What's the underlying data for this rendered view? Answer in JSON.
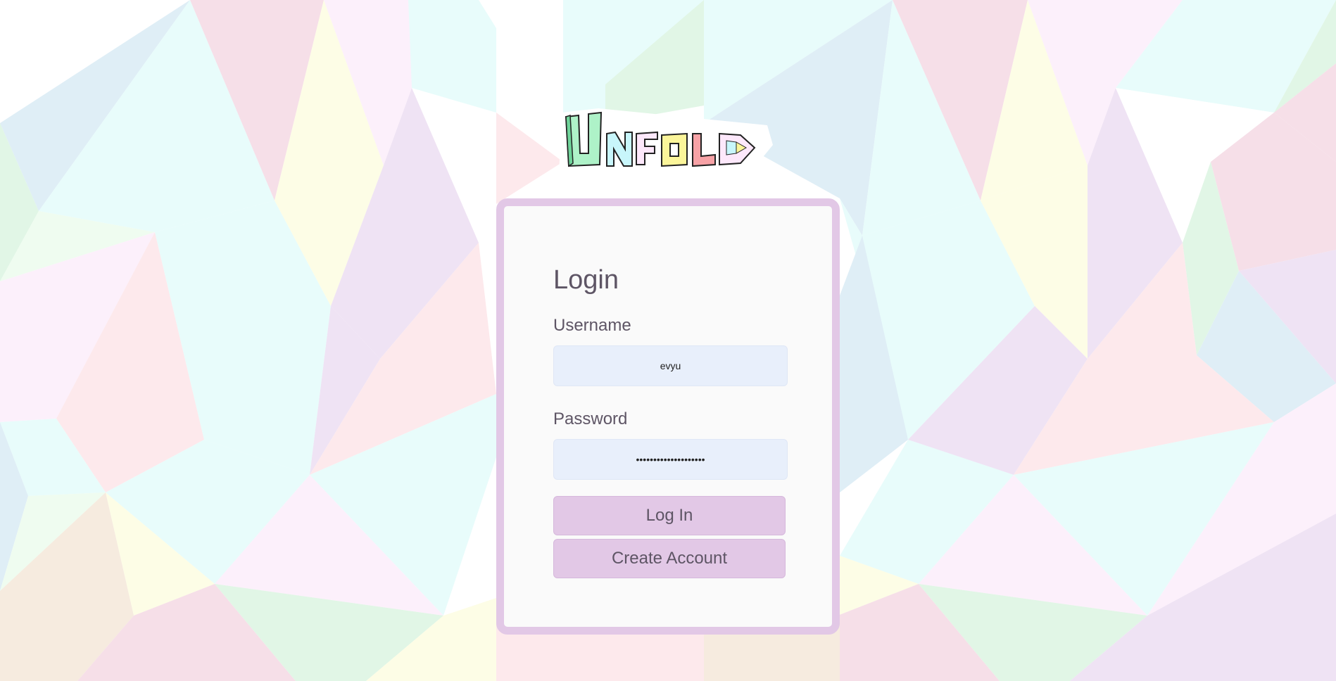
{
  "app": {
    "logo_text": "UNFOLD"
  },
  "login": {
    "title": "Login",
    "username_label": "Username",
    "username_value": "evyu",
    "password_label": "Password",
    "password_value": "••••••••••••••••••••",
    "login_button": "Log In",
    "create_account_button": "Create Account"
  },
  "theme": {
    "card_border": "#e2c8e6",
    "button_bg": "#e2c8e6",
    "input_bg": "#e8effb",
    "text_color": "#5e5565"
  }
}
